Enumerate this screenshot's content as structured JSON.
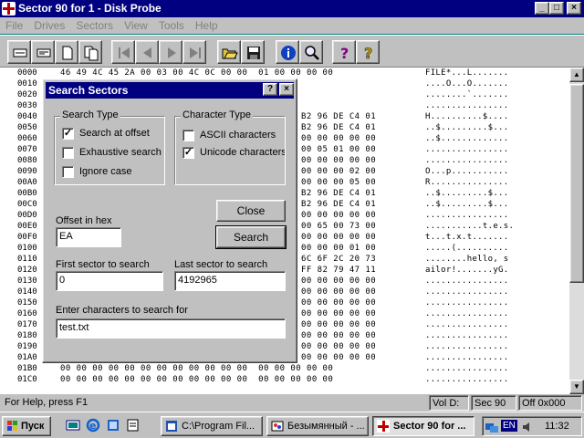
{
  "window": {
    "title": "Sector 90 for 1 - Disk Probe",
    "caption_buttons": {
      "minimize": "_",
      "maximize": "□",
      "close": "×"
    }
  },
  "menu": [
    "File",
    "Drives",
    "Sectors",
    "View",
    "Tools",
    "Help"
  ],
  "toolbar": {
    "buttons": [
      "open-sector-icon",
      "read-sector-icon",
      "write-sector-icon",
      "copy-sector-icon",
      "first-sector-icon",
      "prev-sector-icon",
      "next-sector-icon",
      "last-sector-icon",
      "open-file-icon",
      "save-icon",
      "info-icon",
      "search-icon",
      "help-icon",
      "context-help-icon"
    ]
  },
  "hex_rows": [
    {
      "off": "0000",
      "bytes": "46 49 4C 45 2A 00 03 00 4C 0C 00 00  01 00 00 00 00",
      "ascii": "FILE*...L......."
    },
    {
      "off": "0010",
      "bytes": "",
      "ascii": "....O...O......."
    },
    {
      "off": "0020",
      "bytes": "",
      "ascii": "........`......."
    },
    {
      "off": "0030",
      "bytes": "",
      "ascii": "................"
    },
    {
      "off": "0040",
      "bytes": "B2 96 DE C4 01",
      "ascii": "H..........$...."
    },
    {
      "off": "0050",
      "bytes": "B2 96 DE C4 01",
      "ascii": "..$.........$..."
    },
    {
      "off": "0060",
      "bytes": "00 00 00 00 00",
      "ascii": "..$............."
    },
    {
      "off": "0070",
      "bytes": "00 05 01 00 00",
      "ascii": "................"
    },
    {
      "off": "0080",
      "bytes": "00 00 00 00 00",
      "ascii": "................"
    },
    {
      "off": "0090",
      "bytes": "00 00 00 02 00",
      "ascii": "O...p..........."
    },
    {
      "off": "00A0",
      "bytes": "00 00 00 05 00",
      "ascii": "R..............."
    },
    {
      "off": "00B0",
      "bytes": "B2 96 DE C4 01",
      "ascii": "..$.........$..."
    },
    {
      "off": "00C0",
      "bytes": "B2 96 DE C4 01",
      "ascii": "..$.........$..."
    },
    {
      "off": "00D0",
      "bytes": "00 00 00 00 00",
      "ascii": "................"
    },
    {
      "off": "00E0",
      "bytes": "00 65 00 73 00",
      "ascii": "...........t.e.s."
    },
    {
      "off": "00F0",
      "bytes": "00 00 00 00 00",
      "ascii": "t...t.x.t......."
    },
    {
      "off": "0100",
      "bytes": "00 00 00 01 00",
      "ascii": ".....(.........."
    },
    {
      "off": "0110",
      "bytes": "6C 6F 2C 20 73",
      "ascii": "........hello, s"
    },
    {
      "off": "0120",
      "bytes": "FF 82 79 47 11",
      "ascii": "ailor!.......yG."
    },
    {
      "off": "0130",
      "bytes": "00 00 00 00 00",
      "ascii": "................"
    },
    {
      "off": "0140",
      "bytes": "00 00 00 00 00",
      "ascii": "................"
    },
    {
      "off": "0150",
      "bytes": "00 00 00 00 00",
      "ascii": "................"
    },
    {
      "off": "0160",
      "bytes": "00 00 00 00 00",
      "ascii": "................"
    },
    {
      "off": "0170",
      "bytes": "00 00 00 00 00",
      "ascii": "................"
    },
    {
      "off": "0180",
      "bytes": "00 00 00 00 00",
      "ascii": "................"
    },
    {
      "off": "0190",
      "bytes": "00 00 00 00 00",
      "ascii": "................"
    },
    {
      "off": "01A0",
      "bytes": "00 00 00 00 00",
      "ascii": "................"
    },
    {
      "off": "01B0",
      "bytes": "00 00 00 00 00 00 00 00 00 00 00 00  00 00 00 00 00",
      "ascii": "................"
    },
    {
      "off": "01C0",
      "bytes": "00 00 00 00 00 00 00 00 00 00 00 00  00 00 00 00 00",
      "ascii": "................"
    }
  ],
  "status": {
    "help": "For Help, press F1",
    "vol": "Vol D:",
    "sec": "Sec 90",
    "off": "Off 0x000"
  },
  "dialog": {
    "title": "Search Sectors",
    "help_btn": "?",
    "close_x": "×",
    "search_type": {
      "label": "Search Type",
      "options": [
        {
          "label": "Search at offset",
          "checked": true
        },
        {
          "label": "Exhaustive search",
          "checked": false
        },
        {
          "label": "Ignore case",
          "checked": false
        }
      ]
    },
    "character_type": {
      "label": "Character Type",
      "options": [
        {
          "label": "ASCII characters",
          "checked": false
        },
        {
          "label": "Unicode characters",
          "checked": true
        }
      ]
    },
    "close_button": "Close",
    "search_button": "Search",
    "offset_label": "Offset in hex",
    "offset_value": "EA",
    "first_sector_label": "First sector to search",
    "first_sector_value": "0",
    "last_sector_label": "Last sector to search",
    "last_sector_value": "4192965",
    "chars_label": "Enter characters to search for",
    "chars_value": "test.txt"
  },
  "taskbar": {
    "start": "Пуск",
    "tasks": [
      {
        "label": "C:\\Program Fil...",
        "active": false
      },
      {
        "label": "Безымянный - ...",
        "active": false
      },
      {
        "label": "Sector 90 for ...",
        "active": true
      }
    ],
    "lang": "EN",
    "clock": "11:32"
  }
}
